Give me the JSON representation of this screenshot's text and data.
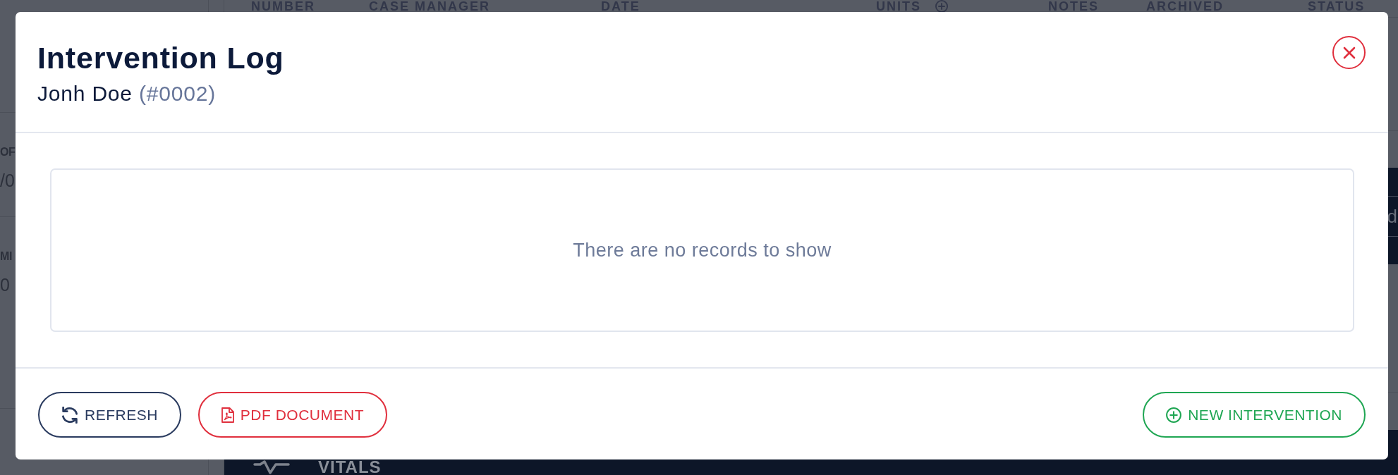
{
  "backdrop": {
    "table_columns": [
      {
        "label": "NUMBER",
        "kind": "text"
      },
      {
        "label": "CASE MANAGER",
        "kind": "text"
      },
      {
        "label": "DATE",
        "kind": "text"
      },
      {
        "label": "UNITS",
        "kind": "add"
      },
      {
        "label": "NOTES",
        "kind": "text"
      },
      {
        "label": "ARCHIVED",
        "kind": "text"
      },
      {
        "label": "STATUS",
        "kind": "text"
      }
    ],
    "sidebar_fields": [
      {
        "label": "OF",
        "value": "/0"
      },
      {
        "label": "MI",
        "value": "0"
      }
    ],
    "band_button": "d",
    "panel_title": "VITALS"
  },
  "modal": {
    "title": "Intervention Log",
    "patient_name": "Jonh Doe",
    "patient_number": "(#0002)",
    "empty_message": "There are no records to show",
    "buttons": [
      {
        "label": "REFRESH",
        "kind": "refresh"
      },
      {
        "label": "PDF DOCUMENT",
        "kind": "pdf"
      },
      {
        "label": "NEW INTERVENTION",
        "kind": "add"
      }
    ]
  }
}
